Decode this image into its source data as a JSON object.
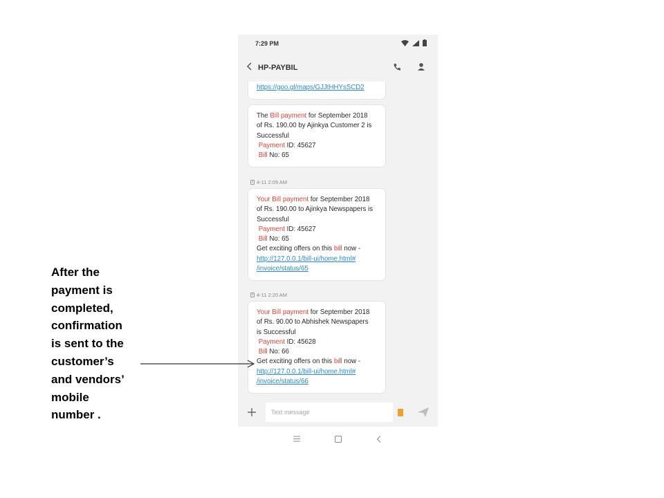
{
  "status_bar": {
    "time": "7:29 PM"
  },
  "header": {
    "contact_name": "HP-PAYBIL"
  },
  "messages": {
    "partial_link": "https://goo.gl/maps/GJJtHHYsSCD2",
    "msg1": {
      "line1_pre": "The ",
      "line1_red": "Bill payment",
      "line1_post": " for September 2018",
      "line2": "of Rs. 190.00 by Ajinkya Customer 2 is",
      "line3": "Successful",
      "payment_word": "Payment",
      "payment_rest": " ID: 45627",
      "bill_word": "Bill",
      "bill_rest": " No: 65"
    },
    "ts2": "4-11 2:09 AM",
    "msg2": {
      "line1_red": "Your Bill payment",
      "line1_post": " for September 2018",
      "line2": "of Rs. 190.00 to Ajinkya Newspapers is",
      "line3": "Successful",
      "payment_word": "Payment",
      "payment_rest": " ID: 45627",
      "bill_word": "Bill",
      "bill_rest": " No: 65",
      "offer_pre": "Get exciting offers on this ",
      "offer_red": "bill",
      "offer_post": " now -",
      "link_a": "http://127.0.0.1/",
      "link_b": "bill",
      "link_c": "-ui/home.html#",
      "link_d": "/invoice/status/65"
    },
    "ts3": "4-11 2:20 AM",
    "msg3": {
      "line1_red": "Your Bill payment",
      "line1_post": " for September 2018",
      "line2": "of Rs. 90.00 to Abhishek Newspapers",
      "line3": "is Successful",
      "payment_word": "Payment",
      "payment_rest": " ID: 45628",
      "bill_word": "Bill",
      "bill_rest": " No: 66",
      "offer_pre": "Get exciting offers on this ",
      "offer_red": "bill",
      "offer_post": " now -",
      "link_a": "http://127.0.0.1/",
      "link_b": "bill",
      "link_c": "-ui/home.html#",
      "link_d": "/invoice/status/66"
    }
  },
  "compose": {
    "placeholder": "Text message"
  },
  "annotation": {
    "text": "After the\npayment is\ncompleted,\nconfirmation\nis sent to the\ncustomer’s\nand vendors’\nmobile\nnumber ."
  },
  "colors": {
    "accent_red": "#e0453a",
    "link_blue": "#2a8ad6",
    "sim_orange": "#f0a030"
  },
  "icons": [
    "wifi-icon",
    "signal-icon",
    "battery-icon",
    "back-arrow-icon",
    "phone-icon",
    "person-icon",
    "plus-icon",
    "sim-icon",
    "send-icon",
    "menu-icon",
    "home-icon",
    "back-nav-icon"
  ]
}
